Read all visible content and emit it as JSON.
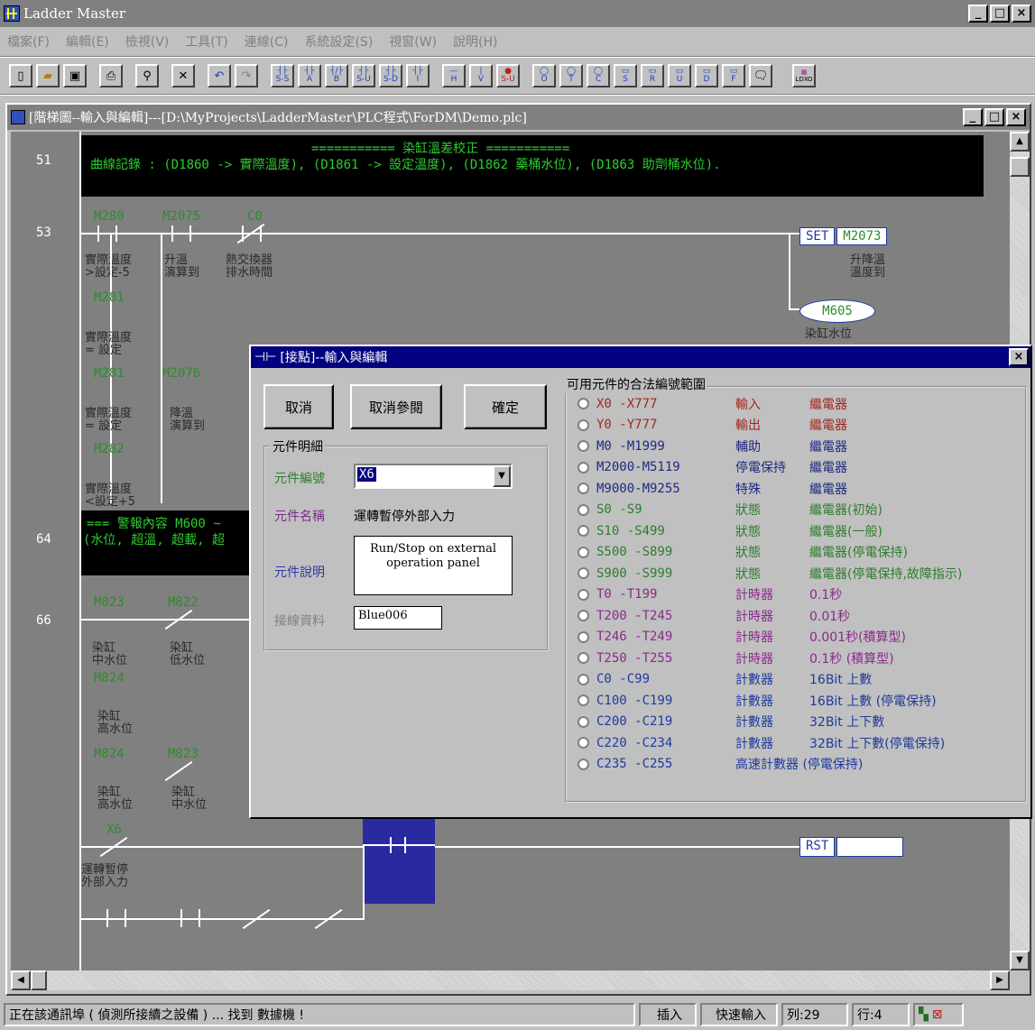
{
  "app": {
    "title": "Ladder Master",
    "win_min": "_",
    "win_max": "□",
    "win_close": "×"
  },
  "menu": [
    "檔案(F)",
    "編輯(E)",
    "檢視(V)",
    "工具(T)",
    "連線(C)",
    "系統設定(S)",
    "視窗(W)",
    "說明(H)"
  ],
  "toolbar": {
    "file_buttons": [
      "new-icon",
      "open-icon",
      "save-icon",
      "print-icon",
      "find-icon",
      "delete-icon",
      "undo-icon",
      "redo-icon"
    ],
    "contact_labels": [
      "S-S",
      "A",
      "B",
      "S-U",
      "S-D",
      "I"
    ],
    "line_labels": [
      "H",
      "V",
      "S-U"
    ],
    "coil_labels": [
      "O",
      "T",
      "C",
      "S",
      "R",
      "U",
      "D",
      "F"
    ],
    "extra_label": "LDXO"
  },
  "child_window": {
    "title": "[階梯圖--輸入與編輯]---[D:\\MyProjects\\LadderMaster\\PLC程式\\ForDM\\Demo.plc]"
  },
  "ladder": {
    "step51": "51",
    "step53": "53",
    "step64": "64",
    "step66": "66",
    "comment51_title": "=========== 染缸溫差校正 ===========",
    "comment51_body": "曲線記錄 : (D1860 -> 實際溫度), (D1861 -> 設定溫度), (D1862 藥桶水位), (D1863 助劑桶水位).",
    "comment64_title": "=== 警報內容 M600 ~",
    "comment64_body": "(水位, 超溫, 超載, 超",
    "r53": {
      "c1": "M280",
      "c1_desc": "實際溫度\n>設定-5",
      "c2": "M2075",
      "c2_desc": "升溫\n演算到",
      "c3": "C0",
      "c3_desc": "熱交換器\n排水時間",
      "c4": "M281",
      "c4_desc": "實際溫度\n= 設定",
      "c5": "M281",
      "c5_desc": "實際溫度\n= 設定",
      "c6": "M2076",
      "c6_desc": "降溫\n演算到",
      "c7": "M282",
      "c7_desc": "實際溫度\n<設定+5",
      "set_label": "SET",
      "set_dev": "M2073",
      "set_desc": "升降溫\n溫度到",
      "coil": "M605",
      "coil_desc": "染缸水位"
    },
    "r66": {
      "c1": "M823",
      "c1_desc": "染缸\n中水位",
      "c2": "M822",
      "c2_desc": "染缸\n低水位",
      "c3": "M824",
      "c3_desc": "染缸\n高水位",
      "c4": "M824",
      "c4_desc": "染缸\n高水位",
      "c5": "M823",
      "c5_desc": "染缸\n中水位",
      "c6": "X6",
      "c6_desc": "運轉暫停\n外部入力",
      "rst_label": "RST",
      "rst_dev": ""
    }
  },
  "dialog": {
    "title": "[接點]--輸入與編輯",
    "close": "×",
    "cancel": "取消",
    "cancel_ref": "取消參閱",
    "ok": "確定",
    "group_detail": "元件明細",
    "label_id": "元件編號",
    "value_id": "X6",
    "label_name": "元件名稱",
    "value_name": "運轉暫停外部入力",
    "label_desc": "元件說明",
    "value_desc": "Run/Stop on external operation panel",
    "label_wire": "接線資料",
    "value_wire": "Blue006",
    "group_ranges": "可用元件的合法編號範圍",
    "ranges": [
      {
        "range": "X0     -X777",
        "cat": "輸入",
        "desc": "繼電器",
        "color": "#a0281e"
      },
      {
        "range": "Y0     -Y777",
        "cat": "輸出",
        "desc": "繼電器",
        "color": "#a0281e"
      },
      {
        "range": "M0     -M1999",
        "cat": "輔助",
        "desc": "繼電器",
        "color": "#1e2a80"
      },
      {
        "range": "M2000-M5119",
        "cat": "停電保持",
        "desc": "繼電器",
        "color": "#1e2a80"
      },
      {
        "range": "M9000-M9255",
        "cat": "特殊",
        "desc": "繼電器",
        "color": "#1e2a80"
      },
      {
        "range": "S0     -S9",
        "cat": "狀態",
        "desc": "繼電器(初始)",
        "color": "#2e7d2e"
      },
      {
        "range": "S10    -S499",
        "cat": "狀態",
        "desc": "繼電器(一般)",
        "color": "#2e7d2e"
      },
      {
        "range": "S500  -S899",
        "cat": "狀態",
        "desc": "繼電器(停電保持)",
        "color": "#2e7d2e"
      },
      {
        "range": "S900  -S999",
        "cat": "狀態",
        "desc": "繼電器(停電保持,故障指示)",
        "color": "#2e7d2e"
      },
      {
        "range": "T0     -T199",
        "cat": "計時器",
        "desc": "0.1秒",
        "color": "#8a2a8a"
      },
      {
        "range": "T200  -T245",
        "cat": "計時器",
        "desc": "0.01秒",
        "color": "#8a2a8a"
      },
      {
        "range": "T246  -T249",
        "cat": "計時器",
        "desc": "0.001秒(積算型)",
        "color": "#8a2a8a"
      },
      {
        "range": "T250  -T255",
        "cat": "計時器",
        "desc": "0.1秒  (積算型)",
        "color": "#8a2a8a"
      },
      {
        "range": "C0     -C99",
        "cat": "計數器",
        "desc": "16Bit 上數",
        "color": "#1e3aa0"
      },
      {
        "range": "C100  -C199",
        "cat": "計數器",
        "desc": "16Bit 上數  (停電保持)",
        "color": "#1e3aa0"
      },
      {
        "range": "C200  -C219",
        "cat": "計數器",
        "desc": "32Bit 上下數",
        "color": "#1e3aa0"
      },
      {
        "range": "C220  -C234",
        "cat": "計數器",
        "desc": "32Bit 上下數(停電保持)",
        "color": "#1e3aa0"
      },
      {
        "range": "C235  -C255",
        "cat": "高速計數器 (停電保持)",
        "desc": "",
        "color": "#1e3aa0"
      }
    ]
  },
  "status": {
    "message": "正在該通訊埠 ( 偵測所接續之設備 ) ... 找到 數據機 !",
    "mode": "插入",
    "input": "快速輸入",
    "col": "列:29",
    "row": "行:4"
  }
}
